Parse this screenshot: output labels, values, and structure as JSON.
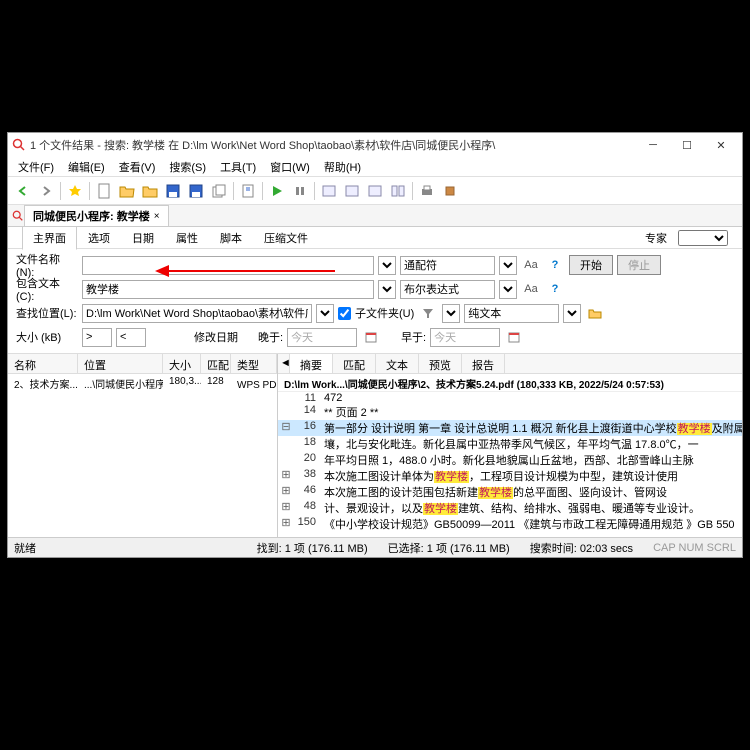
{
  "title": "1 个文件结果 - 搜索: 教学楼 在 D:\\lm Work\\Net Word Shop\\taobao\\素材\\软件店\\同城便民小程序\\",
  "menu": [
    "文件(F)",
    "编辑(E)",
    "查看(V)",
    "搜索(S)",
    "工具(T)",
    "窗口(W)",
    "帮助(H)"
  ],
  "tab_label": "同城便民小程序: 教学楼",
  "sub_tabs": [
    "主界面",
    "选项",
    "日期",
    "属性",
    "脚本",
    "压缩文件"
  ],
  "expert_label": "专家",
  "form": {
    "filename_label": "文件名称(N):",
    "contains_label": "包含文本(C):",
    "contains_value": "教学楼",
    "location_label": "查找位置(L):",
    "location_value": "D:\\lm Work\\Net Word Shop\\taobao\\素材\\软件店\\同城便",
    "subfolders_label": "子文件夹(U)",
    "size_label": "大小 (kB)",
    "modified_label": "修改日期",
    "late_label": "晚于:",
    "early_label": "早于:",
    "today1": "今天",
    "today2": "今天",
    "wildcard_label": "通配符",
    "boolean_label": "布尔表达式",
    "plaintext_label": "纯文本",
    "start_btn": "开始",
    "stop_btn": "停止"
  },
  "list_headers": [
    "名称",
    "位置",
    "大小",
    "匹配",
    "类型"
  ],
  "list_row": {
    "name": "2、技术方案...",
    "location": "...\\同城便民小程序\\",
    "size": "180,3...",
    "match": "128",
    "type": "WPS PDF 文档"
  },
  "right_tabs": [
    "摘要",
    "匹配",
    "文本",
    "预览",
    "报告"
  ],
  "path_line": "D:\\lm Work...\\同城便民小程序\\2、技术方案5.24.pdf   (180,333 KB,  2022/5/24 0:57:53)",
  "lines": [
    {
      "exp": "",
      "n": "11",
      "t": "472",
      "hl": false
    },
    {
      "exp": "",
      "n": "14",
      "t": "** 页面 2 **",
      "hl": false
    },
    {
      "exp": "⊟",
      "n": "16",
      "t": "第一部分 设计说明 第一章 设计总说明 1.1 概况 新化县上渡街道中心学校<mark>教学楼</mark>及附属",
      "hl": true
    },
    {
      "exp": "",
      "n": "18",
      "t": "壤，北与安化毗连。新化县属中亚热带季风气候区，年平均气温 17.8.0℃，一",
      "hl": false
    },
    {
      "exp": "",
      "n": "20",
      "t": "年平均日照 1，488.0 小时。新化县地貌属山丘盆地，西部、北部雪峰山主脉",
      "hl": false
    },
    {
      "exp": "⊞",
      "n": "38",
      "t": "本次施工图设计单体为<mark>教学楼</mark>，工程项目设计规模为中型，建筑设计使用",
      "hl": false
    },
    {
      "exp": "⊞",
      "n": "46",
      "t": "本次施工图的设计范围包括新建<mark>教学楼</mark>的总平面图、竖向设计、管网设",
      "hl": false
    },
    {
      "exp": "⊞",
      "n": "48",
      "t": "计、景观设计，以及<mark>教学楼</mark>建筑、结构、给排水、强弱电、暖通等专业设计。",
      "hl": false
    },
    {
      "exp": "⊞",
      "n": "150",
      "t": "  《中小学校设计规范》GB50099—2011 《建筑与市政工程无障碍通用规范 》GB 550",
      "hl": false
    }
  ],
  "status": {
    "ready": "就绪",
    "found": "找到: 1 项 (176.11 MB)",
    "selected": "已选择: 1 项 (176.11 MB)",
    "time": "搜索时间: 02:03 secs",
    "caps": "CAP NUM SCRL"
  }
}
